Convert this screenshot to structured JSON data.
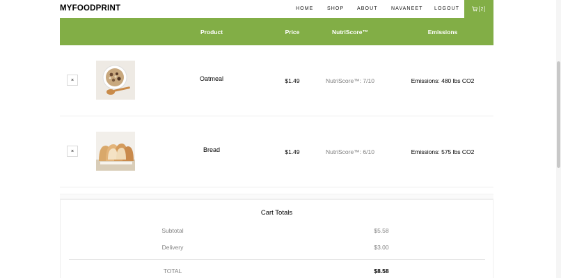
{
  "brand": "MYFOODPRINT",
  "nav": {
    "items": [
      "HOME",
      "SHOP",
      "ABOUT",
      "NAVANEET",
      "LOGOUT"
    ],
    "cart_label": "[2]",
    "cart_icon": "cart-icon"
  },
  "colors": {
    "accent": "#82ae46",
    "muted_text": "#808080"
  },
  "table": {
    "headers": {
      "product": "Product",
      "price": "Price",
      "nutri": "NutriScore™",
      "emissions": "Emissions"
    },
    "rows": [
      {
        "remove": "×",
        "image": "oatmeal-bowl",
        "name": "Oatmeal",
        "price": "$1.49",
        "nutri": "NutriScore™: 7/10",
        "emissions": "Emissions: 480 lbs CO2"
      },
      {
        "remove": "×",
        "image": "sliced-bread",
        "name": "Bread",
        "price": "$1.49",
        "nutri": "NutriScore™: 6/10",
        "emissions": "Emissions: 575 lbs CO2"
      }
    ]
  },
  "totals": {
    "title": "Cart Totals",
    "subtotal_label": "Subtotal",
    "subtotal_value": "$5.58",
    "delivery_label": "Delivery",
    "delivery_value": "$3.00",
    "total_label": "TOTAL",
    "total_value": "$8.58"
  }
}
